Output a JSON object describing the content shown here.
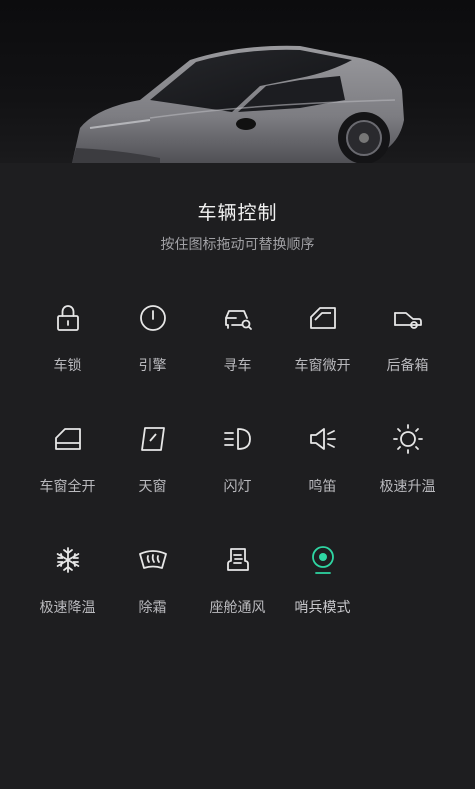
{
  "header": {
    "title": "车辆控制",
    "subtitle": "按住图标拖动可替换顺序"
  },
  "colors": {
    "background": "#1e1e20",
    "icon": "#e6e6e6",
    "accent": "#2fd6a3"
  },
  "controls": [
    {
      "label": "车锁",
      "icon": "lock-icon"
    },
    {
      "label": "引擎",
      "icon": "power-icon"
    },
    {
      "label": "寻车",
      "icon": "find-car-icon"
    },
    {
      "label": "车窗微开",
      "icon": "window-crack-icon"
    },
    {
      "label": "后备箱",
      "icon": "trunk-icon"
    },
    {
      "label": "车窗全开",
      "icon": "window-open-icon"
    },
    {
      "label": "天窗",
      "icon": "sunroof-icon"
    },
    {
      "label": "闪灯",
      "icon": "headlight-icon"
    },
    {
      "label": "鸣笛",
      "icon": "horn-icon"
    },
    {
      "label": "极速升温",
      "icon": "sun-icon"
    },
    {
      "label": "极速降温",
      "icon": "snowflake-icon"
    },
    {
      "label": "除霜",
      "icon": "defrost-icon"
    },
    {
      "label": "座舱通风",
      "icon": "seat-vent-icon"
    },
    {
      "label": "哨兵模式",
      "icon": "sentry-camera-icon"
    }
  ]
}
